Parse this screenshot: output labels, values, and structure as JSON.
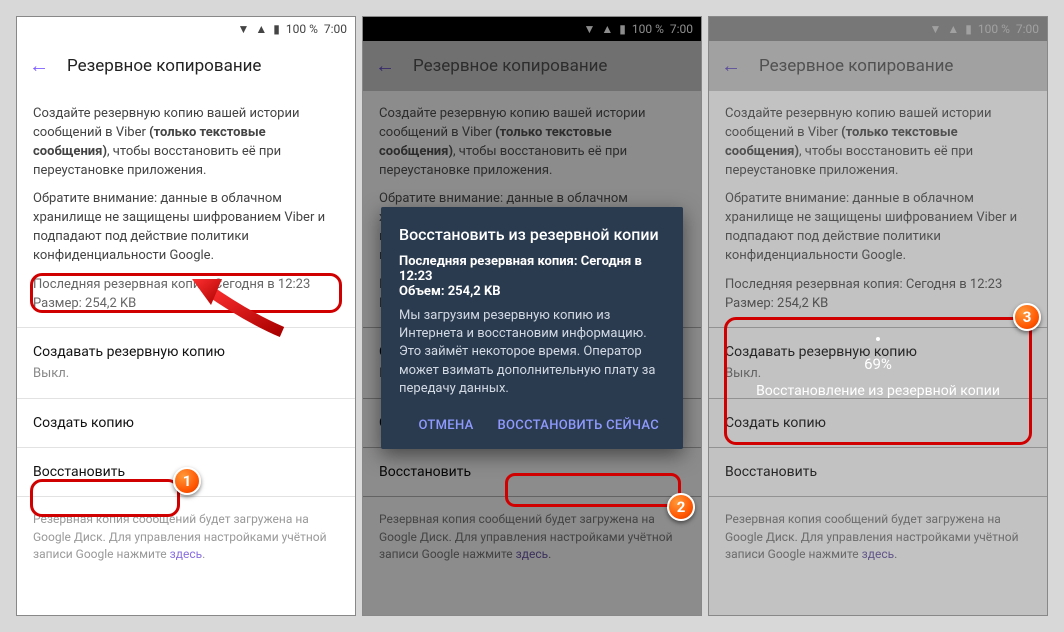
{
  "status": {
    "battery": "100 %",
    "time": "7:00"
  },
  "appbar": {
    "title": "Резервное копирование"
  },
  "content": {
    "intro1": "Создайте резервную копию вашей истории сообщений в Viber ",
    "intro_bold": "(только текстовые сообщения)",
    "intro2": ", чтобы восстановить её при переустановке приложения.",
    "note": "Обратите внимание: данные в облачном хранилище не защищены шифрованием Viber и подпадают под действие политики конфиденциальности Google.",
    "last_backup_line": "Последняя резервная копия: Сегодня в 12:23",
    "size_line": "Размер: 254,2 KB",
    "schedule_title": "Создавать резервную копию",
    "schedule_sub": "Выкл.",
    "create_now": "Создать копию",
    "restore": "Восстановить",
    "footer1": "Резервная копия сообщений будет загружена на Google Диск. Для управления настройками учётной записи Google нажмите ",
    "footer_link": "здесь",
    "footer2": "."
  },
  "dialog": {
    "title": "Восстановить из резервной копии",
    "meta1": "Последняя резервная копия: Сегодня в 12:23",
    "meta2": "Объем: 254,2 KB",
    "body": "Мы загрузим резервную копию из Интернета и восстановим информацию.\nЭто займёт некоторое время. Оператор может взимать дополнительную плату за передачу данных.",
    "cancel": "ОТМЕНА",
    "confirm": "ВОССТАНОВИТЬ СЕЙЧАС"
  },
  "progress": {
    "percent": "69%",
    "label": "Восстановление из резервной копии"
  },
  "badges": {
    "b1": "1",
    "b2": "2",
    "b3": "3"
  }
}
